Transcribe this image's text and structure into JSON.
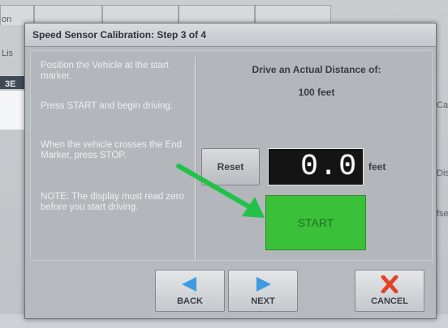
{
  "dialog": {
    "title": "Speed Sensor Calibration:  Step 3 of 4"
  },
  "instructions": [
    "Position the Vehicle at the start marker.",
    "Press START and begin driving.",
    "When the vehicle crosses the End Marker, press STOP.",
    "NOTE:  The display must read zero before you start driving."
  ],
  "distance": {
    "heading": "Drive an Actual Distance of:",
    "value_text": "100 feet"
  },
  "controls": {
    "reset_label": "Reset",
    "display_value": "0.0",
    "unit": "feet",
    "start_label": "START"
  },
  "buttons": {
    "back_label": "BACK",
    "next_label": "NEXT",
    "cancel_label": "CANCEL"
  },
  "background": {
    "edge_left_top": "on",
    "edge_left_mid": "Lis",
    "edge_left_dark": "3E",
    "edge_right_ca": "Ca",
    "edge_right_dist": "Dist",
    "edge_right_fse": "fse"
  },
  "colors": {
    "start_green": "#3bc03a",
    "arrow_green": "#22c24a",
    "cancel_red": "#e0442a",
    "nav_blue": "#3d9be0"
  },
  "icons": {
    "back": "triangle-left-icon",
    "next": "triangle-right-icon",
    "cancel": "x-icon",
    "annotation": "green-arrow-icon"
  }
}
